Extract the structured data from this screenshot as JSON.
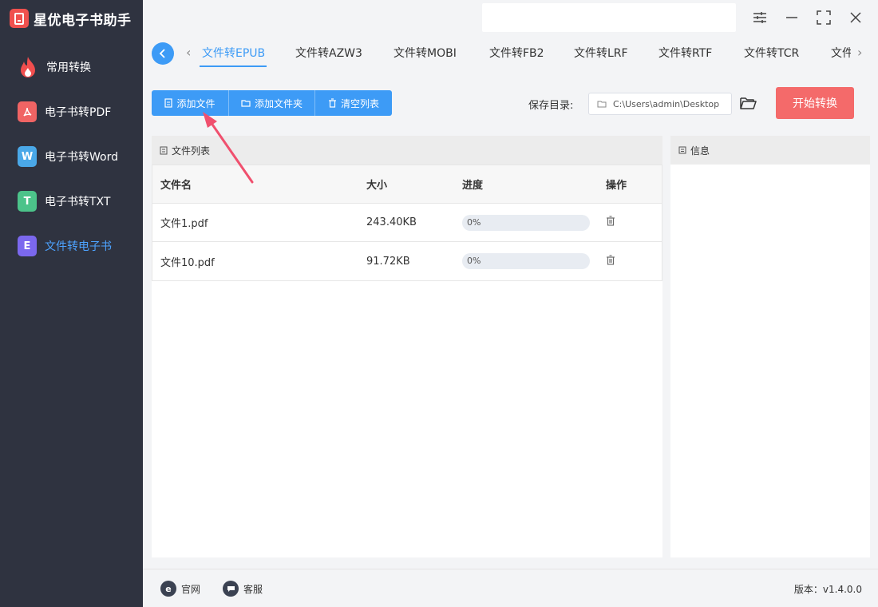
{
  "app": {
    "name": "星优电子书助手"
  },
  "sidebar": {
    "items": [
      {
        "label": "常用转换",
        "icon": "flame-icon",
        "color": "#f04e4e"
      },
      {
        "label": "电子书转PDF",
        "icon": "pdf-icon",
        "color": "#f06464"
      },
      {
        "label": "电子书转Word",
        "icon": "word-icon",
        "glyph": "W",
        "color": "#4aa8e8"
      },
      {
        "label": "电子书转TXT",
        "icon": "txt-icon",
        "glyph": "T",
        "color": "#4cc38a"
      },
      {
        "label": "文件转电子书",
        "icon": "ebook-icon",
        "glyph": "E",
        "color": "#7b68ee",
        "active": true
      }
    ]
  },
  "tabs": {
    "items": [
      "文件转EPUB",
      "文件转AZW3",
      "文件转MOBI",
      "文件转FB2",
      "文件转LRF",
      "文件转RTF",
      "文件转TCR",
      "文件转"
    ],
    "active_index": 0
  },
  "toolbar": {
    "add_file": "添加文件",
    "add_folder": "添加文件夹",
    "clear_list": "清空列表",
    "save_label": "保存目录:",
    "save_path": "C:\\Users\\admin\\Desktop",
    "start": "开始转换"
  },
  "file_list": {
    "title": "文件列表",
    "columns": [
      "文件名",
      "大小",
      "进度",
      "操作"
    ],
    "rows": [
      {
        "name": "文件1.pdf",
        "size": "243.40KB",
        "progress_text": "0%",
        "progress": 0
      },
      {
        "name": "文件10.pdf",
        "size": "91.72KB",
        "progress_text": "0%",
        "progress": 0
      }
    ]
  },
  "info": {
    "title": "信息"
  },
  "footer": {
    "website": "官网",
    "service": "客服",
    "version": "版本：v1.4.0.0"
  },
  "colors": {
    "accent": "#3d9bf6",
    "start_button": "#f46a6a",
    "sidebar_bg": "#2f3340"
  }
}
